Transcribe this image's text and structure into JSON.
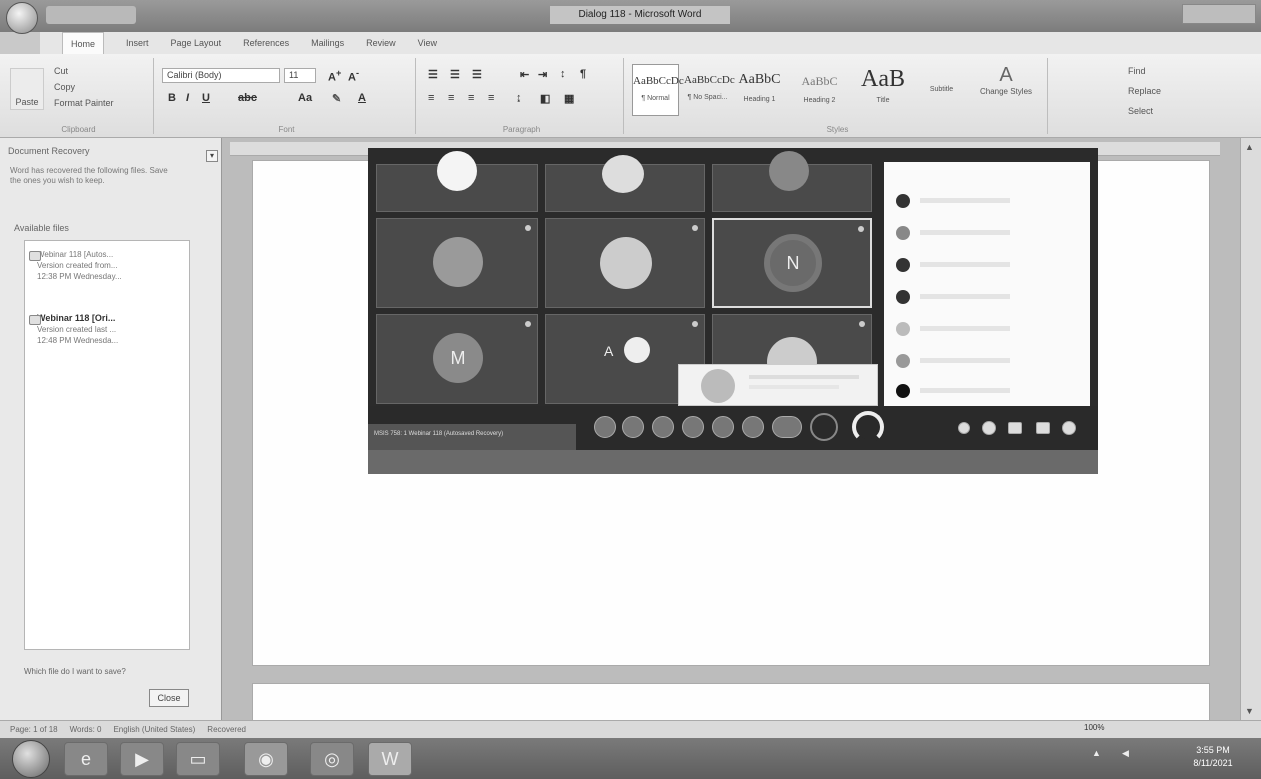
{
  "title_bar": {
    "document_title": "Dialog 118 - Microsoft Word",
    "quick_access": "",
    "window_controls": ""
  },
  "ribbon_tabs": [
    "Home",
    "Insert",
    "Page Layout",
    "References",
    "Mailings",
    "Review",
    "View"
  ],
  "ribbon": {
    "clipboard": {
      "paste": "Paste",
      "cut": "Cut",
      "copy": "Copy",
      "format_painter": "Format Painter",
      "label": "Clipboard"
    },
    "font": {
      "name": "Calibri (Body)",
      "size": "11",
      "label": "Font"
    },
    "paragraph": {
      "label": "Paragraph"
    },
    "styles": [
      {
        "sample": "AaBbCcDc",
        "name": "¶ Normal"
      },
      {
        "sample": "AaBbCcDc",
        "name": "¶ No Spaci..."
      },
      {
        "sample": "AaBbC",
        "name": "Heading 1"
      },
      {
        "sample": "AaBbC",
        "name": "Heading 2"
      },
      {
        "sample": "AaB",
        "name": "Title"
      },
      {
        "sample": "",
        "name": "Subtitle"
      }
    ],
    "styles_label": "Styles",
    "change_styles": "Change Styles",
    "editing": {
      "find": "Find",
      "replace": "Replace",
      "select": "Select"
    }
  },
  "recovery_pane": {
    "title": "Document Recovery",
    "description": "Word has recovered the following files. Save the ones you wish to keep.",
    "available_label": "Available files",
    "files": [
      {
        "name": "Webinar 118 [Autos...",
        "line1": "Version created from...",
        "line2": "12:38 PM Wednesday..."
      },
      {
        "name": "Webinar 118 [Ori...",
        "line1": "Version created last ...",
        "line2": "12:48 PM Wednesda..."
      }
    ],
    "which_file": "Which file do I want to save?",
    "close_button": "Close"
  },
  "embedded_call": {
    "tile_letters": [
      "N",
      "M",
      "A"
    ],
    "tab_text": "MSIS 758: 1 Webinar 118 (Autosaved Recovery)"
  },
  "status_bar": {
    "page": "Page: 1 of 18",
    "words": "Words: 0",
    "language": "English (United States)",
    "recovered": "Recovered",
    "zoom": "100%"
  },
  "taskbar": {
    "clock_time": "3:55 PM",
    "clock_date": "8/11/2021"
  }
}
